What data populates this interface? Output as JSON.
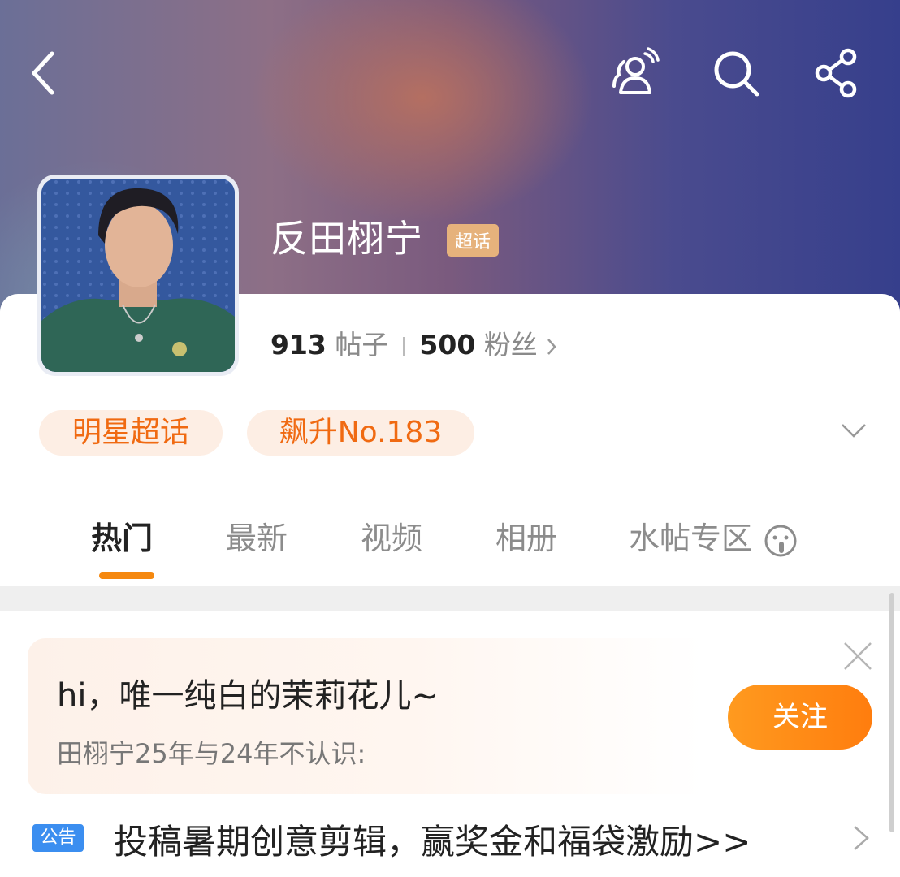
{
  "header": {
    "back_icon": "chevron-left-icon",
    "actions": [
      "group-icon",
      "search-icon",
      "share-icon"
    ]
  },
  "topic": {
    "name": "反田栩宁",
    "badge": "超话",
    "posts_count": "913",
    "posts_label": "帖子",
    "fans_count": "500",
    "fans_label": "粉丝",
    "tags": [
      "明星超话",
      "飙升No.183"
    ]
  },
  "tabs": [
    {
      "label": "热门",
      "active": true
    },
    {
      "label": "最新",
      "active": false
    },
    {
      "label": "视频",
      "active": false
    },
    {
      "label": "相册",
      "active": false
    },
    {
      "label": "水帖专区",
      "active": false
    }
  ],
  "welcome_card": {
    "title": "hi，唯一纯白的茉莉花儿~",
    "subtitle": "田栩宁25年与24年不认识:",
    "follow_label": "关注"
  },
  "notice": {
    "tag": "公告",
    "text": "投稿暑期创意剪辑，赢奖金和福袋激励>>"
  },
  "colors": {
    "accent": "#f5880f",
    "chip_text": "#f06a12",
    "badge": "#e6b27c",
    "notice_tag": "#3b8ef0"
  }
}
